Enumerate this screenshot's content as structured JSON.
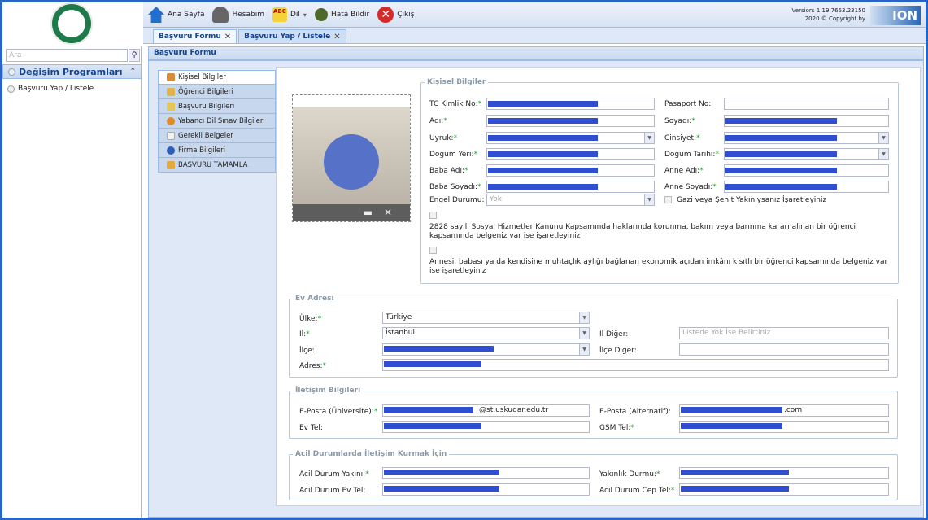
{
  "topbar": {
    "home": "Ana Sayfa",
    "account": "Hesabım",
    "language": "Dil",
    "report_bug": "Hata Bildir",
    "logout": "Çıkış",
    "version_line1": "Version: 1.19.7653.23150",
    "version_line2": "2020 © Copyright by",
    "brand": "ION"
  },
  "tabs": [
    {
      "label": "Başvuru Formu"
    },
    {
      "label": "Başvuru Yap / Listele"
    }
  ],
  "sidebar": {
    "search_placeholder": "Ara",
    "section": "Değişim Programları",
    "items": [
      {
        "label": "Başvuru Yap / Listele"
      }
    ]
  },
  "panel_title": "Başvuru Formu",
  "nav": [
    {
      "label": "Kişisel Bilgiler"
    },
    {
      "label": "Öğrenci Bilgileri"
    },
    {
      "label": "Başvuru Bilgileri"
    },
    {
      "label": "Yabancı Dil Sınav Bilgileri"
    },
    {
      "label": "Gerekli Belgeler"
    },
    {
      "label": "Firma Bilgileri"
    },
    {
      "label": "BAŞVURU TAMAMLA"
    }
  ],
  "personal": {
    "legend": "Kişisel Bilgiler",
    "tc_label": "TC Kimlik No:",
    "passport_label": "Pasaport No:",
    "name_label": "Adı:",
    "surname_label": "Soyadı:",
    "nationality_label": "Uyruk:",
    "gender_label": "Cinsiyet:",
    "birthplace_label": "Doğum Yeri:",
    "birthdate_label": "Doğum Tarihi:",
    "father_name_label": "Baba Adı:",
    "mother_name_label": "Anne Adı:",
    "father_surname_label": "Baba Soyadı:",
    "mother_surname_label": "Anne Soyadı:",
    "disability_label": "Engel Durumu:",
    "disability_value": "Yok",
    "martyr_label": "Gazi veya Şehit Yakınıysanız İşaretleyiniz",
    "para1": "2828 sayılı Sosyal Hizmetler Kanunu Kapsamında haklarında korunma, bakım veya barınma kararı alınan bir öğrenci kapsamında belgeniz var ise işaretleyiniz",
    "para2": "Annesi, babası ya da kendisine muhtaçlık aylığı bağlanan ekonomik açıdan imkânı kısıtlı bir öğrenci kapsamında belgeniz var ise işaretleyiniz"
  },
  "address": {
    "legend": "Ev Adresi",
    "country_label": "Ülke:",
    "country_value": "Türkiye",
    "city_label": "İl:",
    "city_value": "İstanbul",
    "other_city_label": "İl Diğer:",
    "other_city_placeholder": "Listede Yok İse Belirtiniz",
    "district_label": "İlçe:",
    "other_district_label": "İlçe Diğer:",
    "address_label": "Adres:"
  },
  "contact": {
    "legend": "İletişim Bilgileri",
    "email_uni_label": "E-Posta (Üniversite):",
    "email_uni_value": "@st.uskudar.edu.tr",
    "email_alt_label": "E-Posta (Alternatif):",
    "email_alt_value": ".com",
    "home_tel_label": "Ev Tel:",
    "gsm_label": "GSM Tel:"
  },
  "emergency": {
    "legend": "Acil Durumlarda İletişim Kurmak İçin",
    "relative_label": "Acil Durum Yakını:",
    "relation_label": "Yakınlık Durmu:",
    "home_tel_label": "Acil Durum Ev Tel:",
    "mobile_label": "Acil Durum Cep Tel:"
  }
}
